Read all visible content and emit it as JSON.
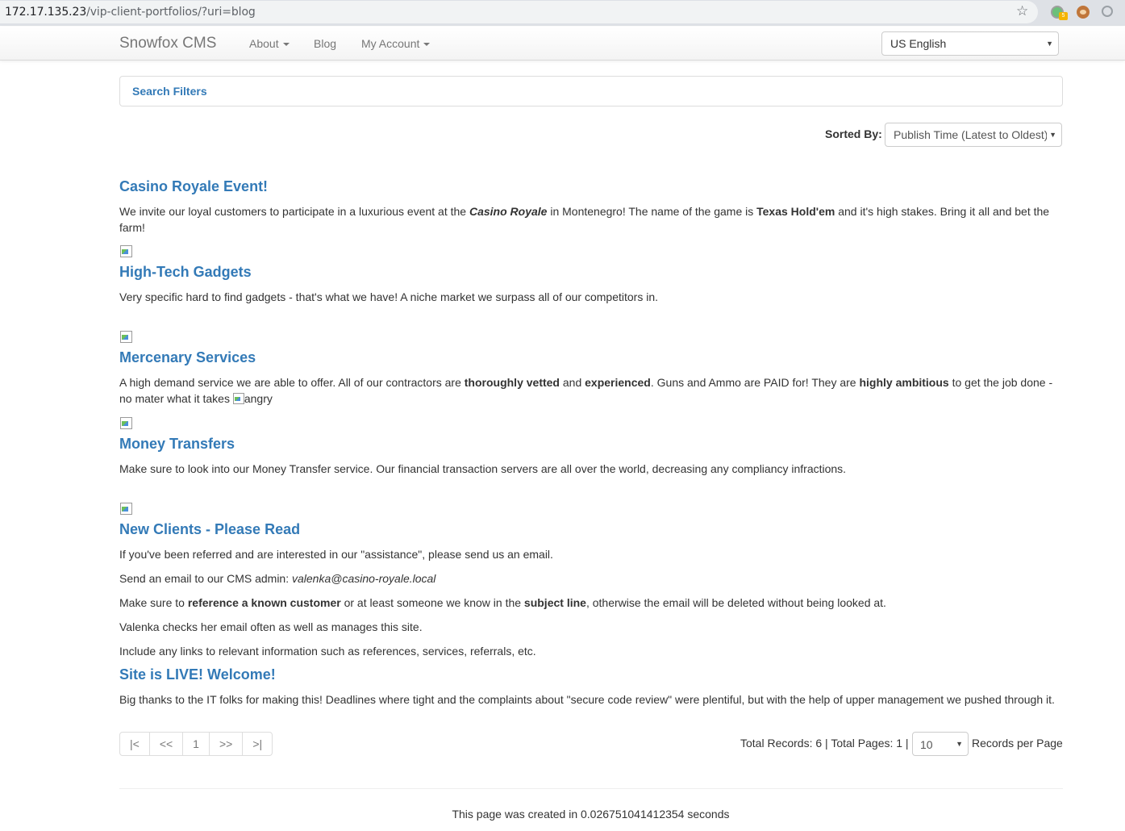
{
  "browser": {
    "url_host": "172.17.135.23",
    "url_path": "/vip-client-portfolios/?uri=blog",
    "ext_badge": "5"
  },
  "navbar": {
    "brand": "Snowfox CMS",
    "items": [
      {
        "label": "About"
      },
      {
        "label": "Blog"
      },
      {
        "label": "My Account"
      }
    ],
    "language": "US English"
  },
  "filters": {
    "title": "Search Filters",
    "sort_label": "Sorted By:",
    "sort_value": "Publish Time (Latest to Oldest)"
  },
  "posts": {
    "p1": {
      "title": "Casino Royale Event!",
      "t1": "We invite our loyal customers to participate in a luxurious event at the ",
      "b1": "Casino Royale",
      "t2": " in Montenegro! The name of the game is ",
      "b2": "Texas Hold'em",
      "t3": " and it's high stakes. Bring it all and bet the farm!"
    },
    "p2": {
      "title": "High-Tech Gadgets",
      "text": "Very specific hard to find gadgets - that's what we have! A niche market we surpass all of our competitors in."
    },
    "p3": {
      "title": "Mercenary Services",
      "t1": "A high demand service we are able to offer. All of our contractors are ",
      "b1": "thoroughly vetted",
      "t2": " and ",
      "b2": "experienced",
      "t3": ". Guns and Ammo are PAID for! They are ",
      "b3": "highly ambitious",
      "t4": " to get the job done - no mater what it takes ",
      "img_alt": "angry"
    },
    "p4": {
      "title": "Money Transfers",
      "text": "Make sure to look into our Money Transfer service. Our financial transaction servers are all over the world, decreasing any compliancy infractions."
    },
    "p5": {
      "title": "New Clients - Please Read",
      "l1": "If you've been referred and are interested in our \"assistance\", please send us an email.",
      "l2a": "Send an email to our CMS admin: ",
      "l2b": "valenka@casino-royale.local",
      "l3a": "Make sure to ",
      "l3b": "reference a known customer",
      "l3c": " or at least someone we know in the ",
      "l3d": "subject line",
      "l3e": ", otherwise the email will be deleted without being looked at.",
      "l4": "Valenka checks her email often as well as manages this site.",
      "l5": "Include any links to relevant information such as references, services, referrals, etc."
    },
    "p6": {
      "title": "Site is LIVE! Welcome!",
      "text": "Big thanks to the IT folks for making this! Deadlines where tight and the complaints about \"secure code review\" were plentiful, but with the help of upper management we pushed through it."
    }
  },
  "pagination": {
    "first": "|<",
    "prev": "<<",
    "page": "1",
    "next": ">>",
    "last": ">|",
    "records_info": "Total Records: 6 | Total Pages: 1 |",
    "per_page": "10",
    "per_page_label": "Records per Page"
  },
  "footer": {
    "text": "This page was created in 0.026751041412354 seconds"
  }
}
